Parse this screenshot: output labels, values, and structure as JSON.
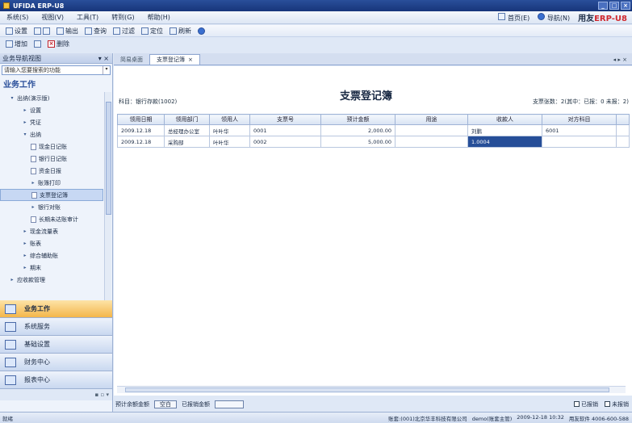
{
  "window": {
    "title": "UFIDA ERP-U8"
  },
  "menu": {
    "items": [
      "系统(S)",
      "视图(V)",
      "工具(T)",
      "转到(G)",
      "帮助(H)"
    ],
    "home": "首页(E)",
    "nav": "导航(N)",
    "brand_prefix": "用友",
    "brand_erp": "ERP-U8"
  },
  "toolbar": {
    "buttons": [
      "设置",
      "输出",
      "查询",
      "过滤",
      "定位",
      "刷新"
    ],
    "buttons2": [
      "增加",
      "删除"
    ]
  },
  "left": {
    "header": "业务导航视图",
    "search_placeholder": "请输入您要搜索的功能",
    "section": "业务工作",
    "tree": [
      {
        "label": "出纳(演示版)",
        "tw": "▾"
      },
      {
        "label": "设置",
        "tw": "▸"
      },
      {
        "label": "凭证",
        "tw": "▸"
      },
      {
        "label": "出纳",
        "tw": "▾"
      },
      {
        "label": "现金日记账",
        "tw": ""
      },
      {
        "label": "银行日记账",
        "tw": ""
      },
      {
        "label": "资金日报",
        "tw": ""
      },
      {
        "label": "账簿打印",
        "tw": "▸"
      },
      {
        "label": "支票登记簿",
        "tw": ""
      },
      {
        "label": "银行对账",
        "tw": "▸"
      },
      {
        "label": "长期未达账审计",
        "tw": ""
      },
      {
        "label": "现金流量表",
        "tw": "▸"
      },
      {
        "label": "账表",
        "tw": "▸"
      },
      {
        "label": "综合辅助账",
        "tw": "▸"
      },
      {
        "label": "期末",
        "tw": "▸"
      },
      {
        "label": "应收款管理",
        "tw": "▸"
      }
    ],
    "nav_buttons": [
      "业务工作",
      "系统服务",
      "基础设置",
      "财务中心",
      "报表中心"
    ]
  },
  "tabs": [
    {
      "label": "简易桌面"
    },
    {
      "label": "支票登记簿"
    }
  ],
  "register": {
    "title": "支票登记簿",
    "subject": "科目：银行存款(1002)",
    "pages": "支票张数：2(其中：已报：0 未报：2)",
    "columns": [
      "领用日期",
      "领用部门",
      "领用人",
      "支票号",
      "预计金额",
      "用途",
      "收款人",
      "对方科目",
      ""
    ],
    "rows": [
      [
        "2009.12.18",
        "总经理办公室",
        "叶叶华",
        "0001",
        "2,000.00",
        "",
        "刘鹏",
        "6001",
        ""
      ],
      [
        "2009.12.18",
        "采购部",
        "叶叶华",
        "0002",
        "5,000.00",
        "",
        "1.0004",
        "",
        ""
      ]
    ]
  },
  "bottom": {
    "label1": "预计余额金额",
    "btn1": "空白",
    "label2": "已报销金额",
    "btn2": "",
    "chk1": "已报销",
    "chk2": "未报销"
  },
  "status": {
    "left": "就绪",
    "account": "账套:(001)北京华丰科技有限公司",
    "user": "demo(账套主管)",
    "date": "2009-12-18 10:32",
    "phone": "用友软件 4006-600-588"
  }
}
